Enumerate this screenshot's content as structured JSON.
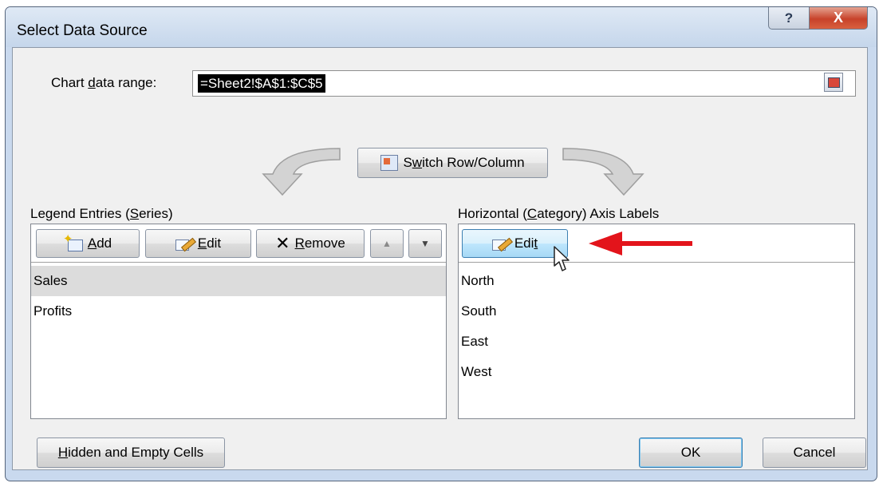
{
  "window": {
    "title": "Select Data Source",
    "help_glyph": "?",
    "close_glyph": "X"
  },
  "range": {
    "label_pre": "Chart ",
    "label_ul": "d",
    "label_post": "ata range:",
    "value": "=Sheet2!$A$1:$C$5"
  },
  "switch": {
    "label_pre": "S",
    "label_ul": "w",
    "label_post": "itch Row/Column"
  },
  "legend": {
    "title_pre": "Legend Entries (",
    "title_ul": "S",
    "title_post": "eries)",
    "add": {
      "ul": "A",
      "post": "dd"
    },
    "edit": {
      "ul": "E",
      "post": "dit"
    },
    "remove": {
      "ul": "R",
      "post": "emove"
    },
    "items": [
      "Sales",
      "Profits"
    ]
  },
  "axis": {
    "title_pre": "Horizontal (",
    "title_ul": "C",
    "title_post": "ategory) Axis Labels",
    "edit": {
      "pre": "Edi",
      "ul": "t"
    },
    "items": [
      "North",
      "South",
      "East",
      "West"
    ]
  },
  "footer": {
    "hidden_ul": "H",
    "hidden_post": "idden and Empty Cells",
    "ok": "OK",
    "cancel": "Cancel"
  },
  "colors": {
    "accent_arrow": "#e3141b",
    "hover_border": "#3c7fb1"
  }
}
